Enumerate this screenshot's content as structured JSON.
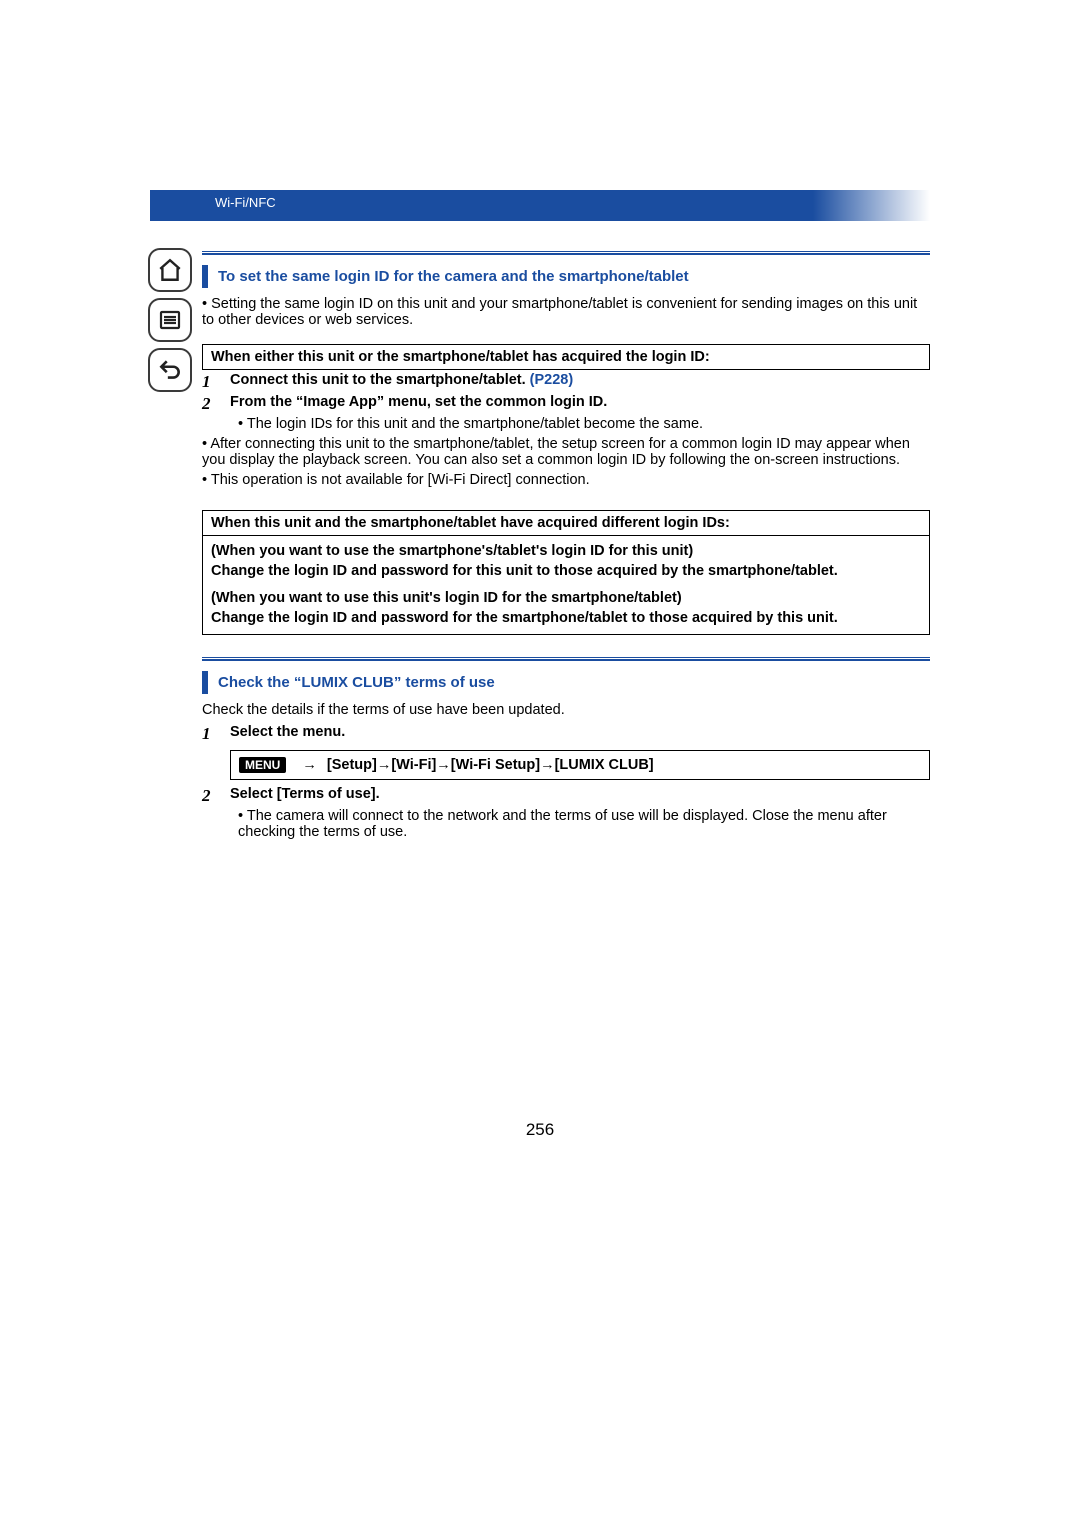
{
  "header": {
    "breadcrumb": "Wi-Fi/NFC"
  },
  "section1": {
    "title": "To set the same login ID for the camera and the smartphone/tablet",
    "intro": "Setting the same login ID on this unit and your smartphone/tablet is convenient for sending images on this unit to other devices or web services.",
    "caseA": {
      "heading": "When either this unit or the smartphone/tablet has acquired the login ID:",
      "step1": "Connect this unit to the smartphone/tablet. ",
      "step1_link": "(P228)",
      "step2": "From the “Image App” menu, set the common login ID.",
      "step2_sub": "The login IDs for this unit and the smartphone/tablet become the same.",
      "note1": "After connecting this unit to the smartphone/tablet, the setup screen for a common login ID may appear when you display the playback screen. You can also set a common login ID by following the on-screen instructions.",
      "note2": "This operation is not available for [Wi-Fi Direct] connection."
    },
    "caseB": {
      "heading": "When this unit and the smartphone/tablet have acquired different login IDs:",
      "body_line1": "(When you want to use the smartphone's/tablet's login ID for this unit)",
      "body_line2": "Change the login ID and password for this unit to those acquired by the smartphone/tablet.",
      "body_line3": "(When you want to use this unit's login ID for the smartphone/tablet)",
      "body_line4": "Change the login ID and password for the smartphone/tablet to those acquired by this unit."
    }
  },
  "section2": {
    "title": "Check the “LUMIX CLUB” terms of use",
    "intro": "Check the details if the terms of use have been updated.",
    "step1": "Select the menu.",
    "menu_tag": "MENU",
    "arrow": "→",
    "menu_path": "[Setup]→[Wi-Fi]→[Wi-Fi Setup]→[LUMIX CLUB]",
    "step2": "Select [Terms of use].",
    "step2_sub": "The camera will connect to the network and the terms of use will be displayed. Close the menu after checking the terms of use."
  },
  "step_numbers": {
    "n1": "1",
    "n2": "2"
  },
  "page_number": "256"
}
